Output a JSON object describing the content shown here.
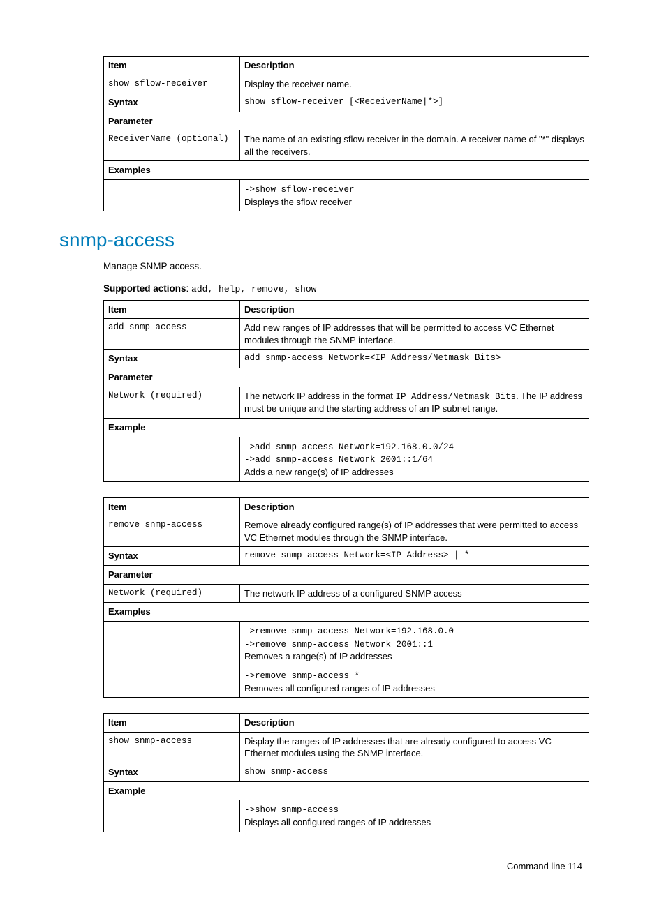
{
  "table1": {
    "h_item": "Item",
    "h_desc": "Description",
    "r1_item": "show sflow-receiver",
    "r1_desc": "Display the receiver name.",
    "syntax_lbl": "Syntax",
    "syntax_val": "show sflow-receiver [<ReceiverName|*>]",
    "param_lbl": "Parameter",
    "r2_item": "ReceiverName (optional)",
    "r2_desc": "The name of an existing sflow receiver in the domain. A receiver name of \"*\" displays all the receivers.",
    "ex_lbl": "Examples",
    "ex_code": "->show sflow-receiver",
    "ex_text": "Displays the sflow receiver"
  },
  "section_title": "snmp-access",
  "intro": "Manage SNMP access.",
  "support_lbl": "Supported actions",
  "support_val": "add, help, remove, show",
  "table2": {
    "h_item": "Item",
    "h_desc": "Description",
    "r1_item": "add snmp-access",
    "r1_desc": "Add new ranges of IP addresses that will be permitted to access VC Ethernet modules through the SNMP interface.",
    "syntax_lbl": "Syntax",
    "syntax_val": "add snmp-access Network=<IP Address/Netmask Bits>",
    "param_lbl": "Parameter",
    "r2_item": "Network (required)",
    "r2_desc_pre": "The network IP address in the format ",
    "r2_desc_code": "IP Address/Netmask Bits",
    "r2_desc_post": ". The IP address must be unique and the starting address of an IP subnet range.",
    "ex_lbl": "Example",
    "ex_code1": "->add snmp-access Network=192.168.0.0/24",
    "ex_code2": "->add snmp-access Network=2001::1/64",
    "ex_text": "Adds a new range(s) of IP addresses"
  },
  "table3": {
    "h_item": "Item",
    "h_desc": "Description",
    "r1_item": "remove snmp-access",
    "r1_desc": "Remove already configured range(s) of IP addresses that were permitted to access VC Ethernet modules through the SNMP interface.",
    "syntax_lbl": "Syntax",
    "syntax_val": "remove snmp-access Network=<IP Address> | *",
    "param_lbl": "Parameter",
    "r2_item": "Network (required)",
    "r2_desc": "The network IP address of a configured SNMP access",
    "ex_lbl": "Examples",
    "ex1_code1": "->remove snmp-access Network=192.168.0.0",
    "ex1_code2": "->remove snmp-access Network=2001::1",
    "ex1_text": "Removes a range(s) of IP addresses",
    "ex2_code": "->remove snmp-access *",
    "ex2_text": "Removes all configured ranges of IP addresses"
  },
  "table4": {
    "h_item": "Item",
    "h_desc": "Description",
    "r1_item": "show snmp-access",
    "r1_desc": "Display the ranges of IP addresses that are already configured to access VC Ethernet modules using the SNMP interface.",
    "syntax_lbl": "Syntax",
    "syntax_val": "show snmp-access",
    "ex_lbl": "Example",
    "ex_code": "->show snmp-access",
    "ex_text": "Displays all configured ranges of IP addresses"
  },
  "footer": "Command line   114"
}
